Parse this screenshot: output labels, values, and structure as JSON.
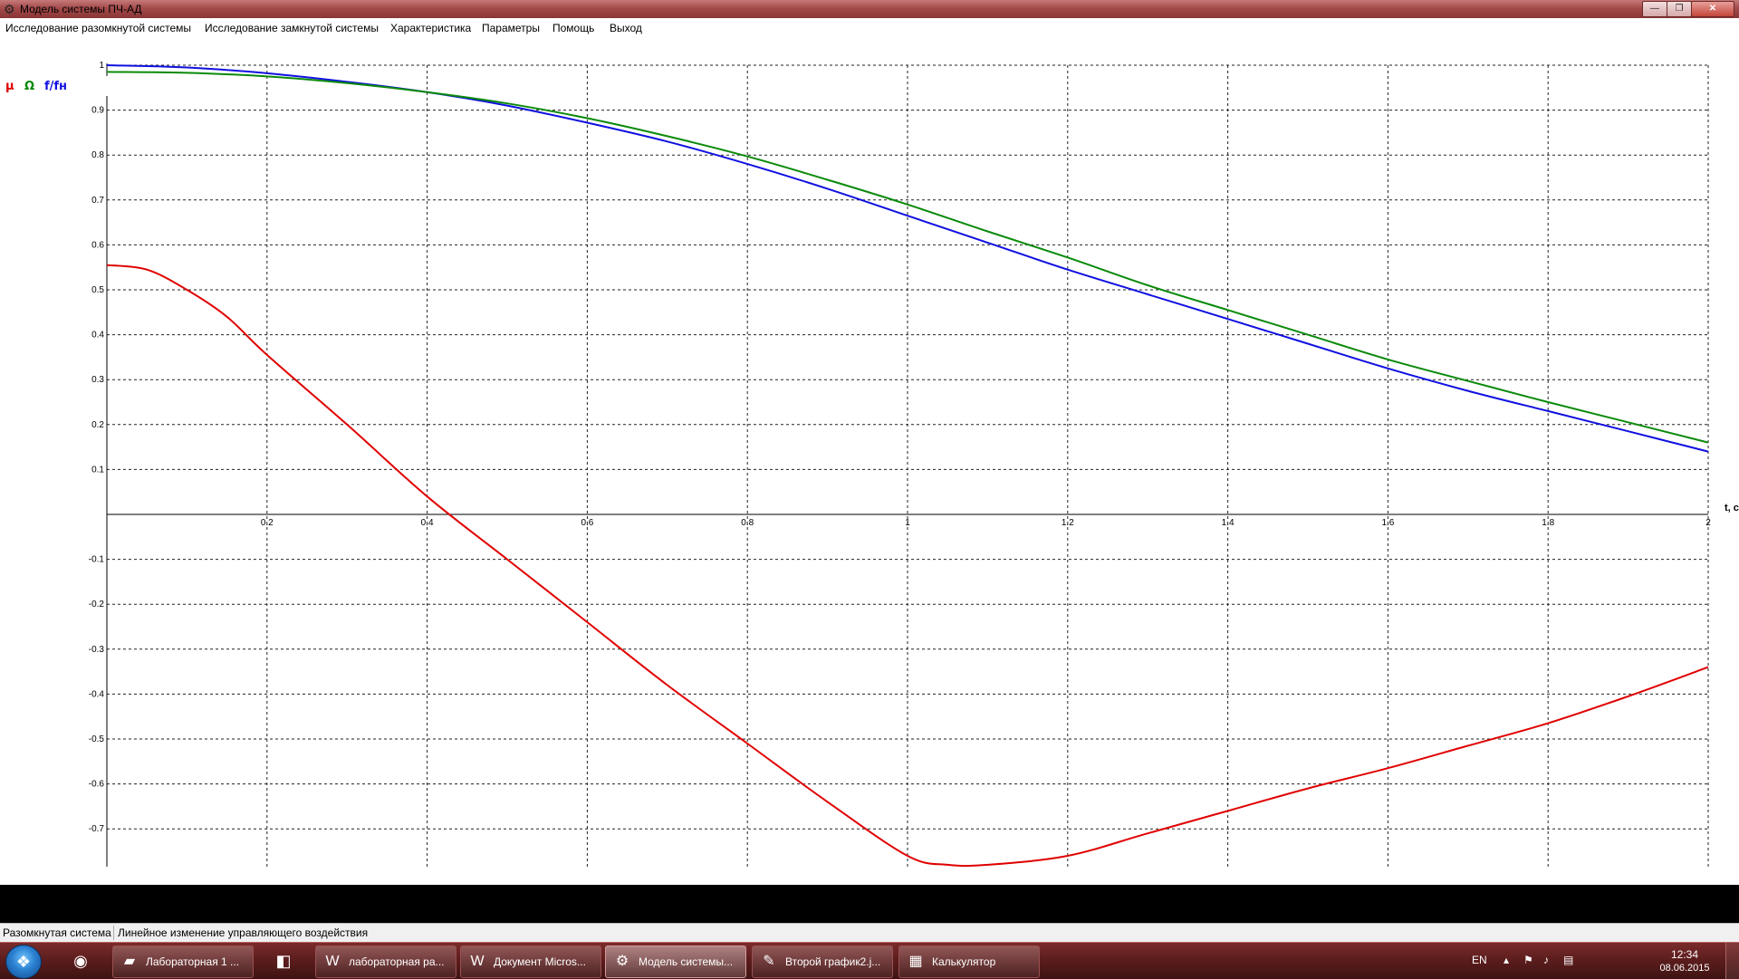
{
  "window": {
    "title": "Модель системы ПЧ-АД",
    "controls": {
      "minimize": "—",
      "maximize": "❐",
      "close": "✕"
    }
  },
  "menu": {
    "items": [
      "Исследование разомкнутой системы",
      "Исследование замкнутой системы",
      "Характеристика",
      "Параметры",
      "Помощь",
      "Выход"
    ]
  },
  "legend": {
    "mu": {
      "label": "μ",
      "color": "#e00000"
    },
    "omega": {
      "label": "Ω",
      "color": "#0a8a0a"
    },
    "freq": {
      "label": "f/fн",
      "color": "#1010e0"
    }
  },
  "chart_data": {
    "type": "line",
    "xlabel": "t, c",
    "ylabel": "",
    "xlim": [
      0,
      2
    ],
    "ylim": [
      -0.8,
      1
    ],
    "x_ticks": [
      0.2,
      0.4,
      0.6,
      0.8,
      1,
      1.2,
      1.4,
      1.6,
      1.8,
      2
    ],
    "x_tick_labels": [
      "0.2",
      "0.4",
      "0.6",
      "0.8",
      "1",
      "1.2",
      "1.4",
      "1.6",
      "1.8",
      "2"
    ],
    "y_ticks": [
      1,
      0.9,
      0.8,
      0.7,
      0.6,
      0.5,
      0.4,
      0.3,
      0.2,
      0.1,
      -0.1,
      -0.2,
      -0.3,
      -0.4,
      -0.5,
      -0.6,
      -0.7
    ],
    "y_tick_labels": [
      "1",
      "0.9",
      "0.8",
      "0.7",
      "0.6",
      "0.5",
      "0.4",
      "0.3",
      "0.2",
      "0.1",
      "-0.1",
      "-0.2",
      "-0.3",
      "-0.4",
      "-0.5",
      "-0.6",
      "-0.7"
    ],
    "grid": true,
    "series": [
      {
        "name": "f/fн",
        "color": "#1010e0",
        "x": [
          0,
          0.1,
          0.2,
          0.3,
          0.4,
          0.5,
          0.6,
          0.7,
          0.8,
          0.9,
          1.0,
          1.1,
          1.2,
          1.3,
          1.4,
          1.5,
          1.6,
          1.7,
          1.8,
          1.9,
          2.0
        ],
        "y": [
          1.0,
          0.995,
          0.982,
          0.963,
          0.94,
          0.91,
          0.872,
          0.83,
          0.78,
          0.725,
          0.665,
          0.605,
          0.545,
          0.49,
          0.435,
          0.38,
          0.325,
          0.275,
          0.23,
          0.185,
          0.14
        ]
      },
      {
        "name": "Ω",
        "color": "#0a8a0a",
        "x": [
          0,
          0.1,
          0.2,
          0.3,
          0.4,
          0.5,
          0.6,
          0.7,
          0.8,
          0.9,
          1.0,
          1.1,
          1.2,
          1.3,
          1.4,
          1.5,
          1.6,
          1.7,
          1.8,
          1.9,
          2.0
        ],
        "y": [
          0.985,
          0.983,
          0.975,
          0.96,
          0.94,
          0.915,
          0.882,
          0.842,
          0.797,
          0.745,
          0.69,
          0.63,
          0.572,
          0.51,
          0.455,
          0.4,
          0.345,
          0.297,
          0.25,
          0.205,
          0.16
        ]
      },
      {
        "name": "μ",
        "color": "#e00000",
        "x": [
          0,
          0.05,
          0.1,
          0.15,
          0.2,
          0.3,
          0.4,
          0.5,
          0.6,
          0.7,
          0.8,
          0.9,
          1.0,
          1.05,
          1.1,
          1.2,
          1.3,
          1.4,
          1.5,
          1.6,
          1.7,
          1.8,
          1.9,
          2.0
        ],
        "y": [
          0.555,
          0.545,
          0.5,
          0.44,
          0.355,
          0.2,
          0.04,
          -0.1,
          -0.24,
          -0.38,
          -0.51,
          -0.64,
          -0.76,
          -0.78,
          -0.78,
          -0.76,
          -0.71,
          -0.66,
          -0.61,
          -0.565,
          -0.515,
          -0.465,
          -0.405,
          -0.34
        ]
      }
    ]
  },
  "status": {
    "mode": "Разомкнутая система",
    "description": "Линейное изменение управляющего воздействия"
  },
  "taskbar": {
    "start_icon": "windows-start-orb",
    "buttons": [
      {
        "label": "Лабораторная 1 ...",
        "icon": "folder-icon",
        "glyph": "📁"
      },
      {
        "label": "лабораторная ра...",
        "icon": "word-document-icon",
        "glyph": "W"
      },
      {
        "label": "Документ Micros...",
        "icon": "word-document-icon",
        "glyph": "W"
      },
      {
        "label": "Модель системы...",
        "icon": "gear-icon",
        "glyph": "⚙",
        "active": true
      },
      {
        "label": "Второй график2.j...",
        "icon": "paint-icon",
        "glyph": "🎨"
      },
      {
        "label": "Калькулятор",
        "icon": "calculator-icon",
        "glyph": "▦"
      }
    ],
    "pinned": [
      {
        "icon": "firefox-icon",
        "glyph": "●"
      },
      {
        "icon": "eraser-icon",
        "glyph": "◧"
      }
    ],
    "tray": {
      "language": "EN",
      "time": "12:34",
      "date": "08.06.2015"
    }
  }
}
